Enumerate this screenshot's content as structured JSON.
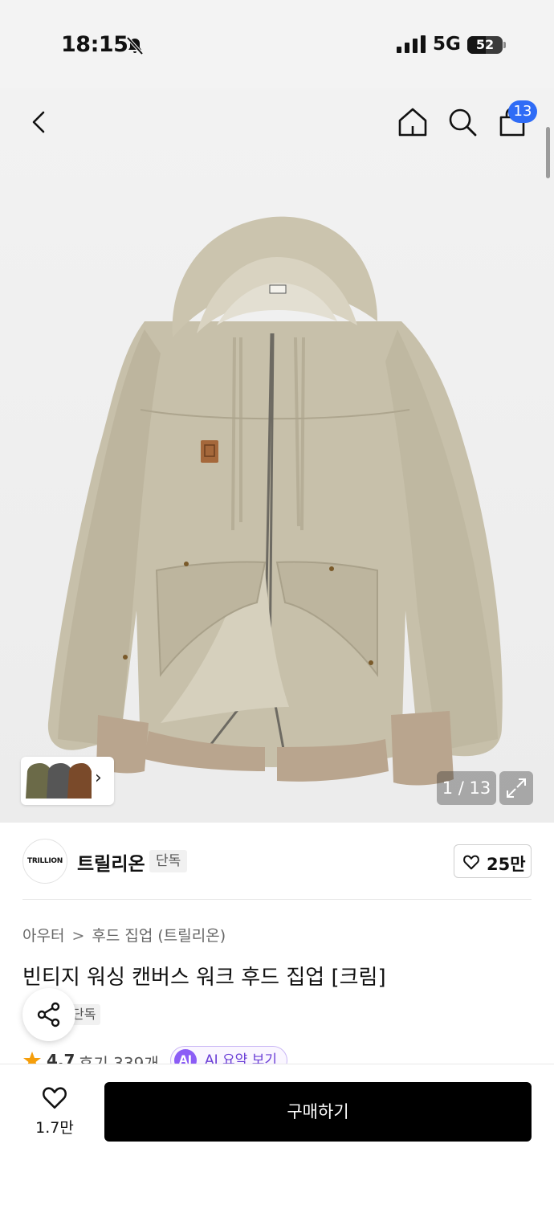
{
  "status_bar": {
    "time": "18:15",
    "network": "5G",
    "battery": "52",
    "battery_level": 0.52
  },
  "header": {
    "cart_count": "13"
  },
  "gallery": {
    "counter": "1 / 13"
  },
  "brand": {
    "logo_text": "TRILLION",
    "name": "트릴리온",
    "badge": "단독",
    "like_count": "25만"
  },
  "breadcrumb": {
    "category": "아우터",
    "separator": ">",
    "subcategory": "후드 집업 (트릴리온)"
  },
  "product": {
    "title": "빈티지 워싱 캔버스 워크 후드 집업 [크림]",
    "tag": "단독",
    "rating": "4.7",
    "review_count": "후기 339개",
    "ai_badge": "AI",
    "ai_summary_label": "AI 요약 보기"
  },
  "bottom_bar": {
    "wish_count": "1.7만",
    "buy_label": "구매하기"
  },
  "colors": {
    "accent_blue": "#2f6cf6",
    "buy_button": "#000000",
    "star": "#f59e0b",
    "ai_purple": "#8b5cf6"
  }
}
